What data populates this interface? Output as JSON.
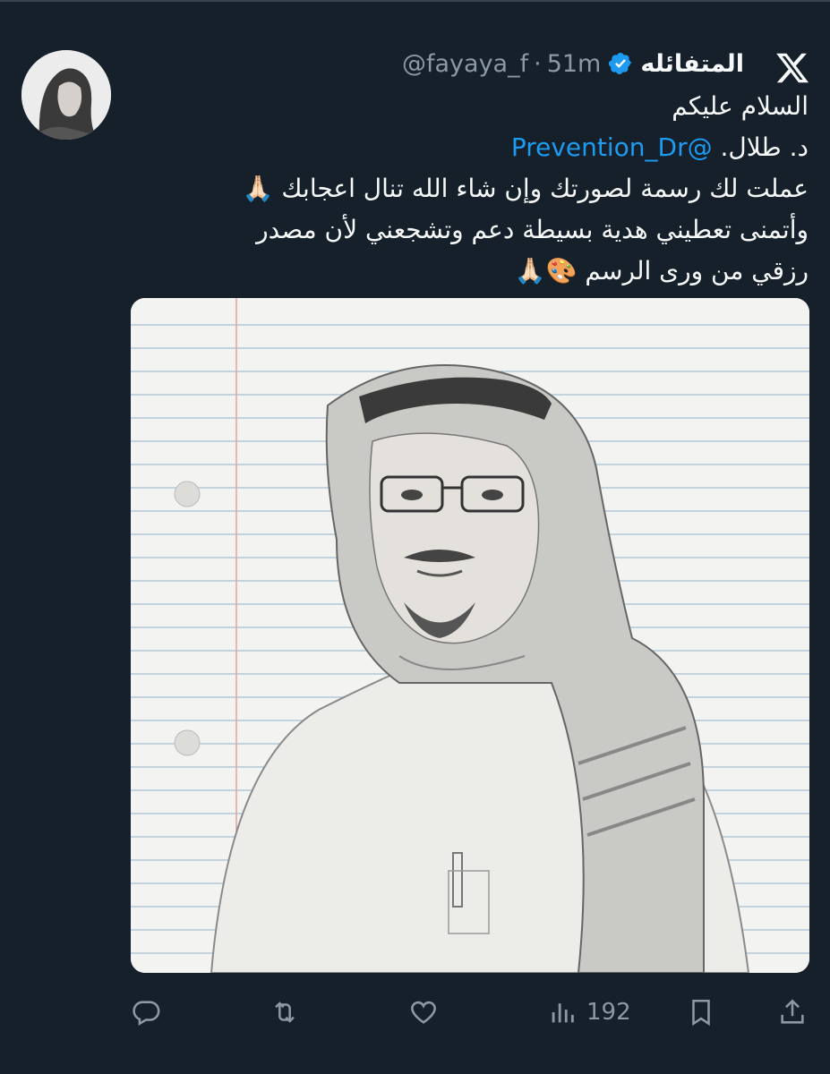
{
  "tweet": {
    "display_name": "المتفائله",
    "handle": "@fayaya_f",
    "separator": "·",
    "time": "51m",
    "lines": [
      {
        "text": "السلام عليكم"
      },
      {
        "mention": "@Prevention_Dr",
        "text": "د. طلال."
      },
      {
        "text": "عملت لك رسمة لصورتك وإن شاء الله  تنال اعجابك",
        "emoji": "🙏🏻"
      },
      {
        "text": "وأتمنى تعطيني هدية بسيطة دعم  وتشجعني لأن مصدر"
      },
      {
        "text": "رزقي من ورى الرسم",
        "emoji": "🎨🙏🏻"
      }
    ],
    "media": {
      "description_icon": "pencil-portrait-drawing"
    }
  },
  "actions": {
    "reply": {
      "icon": "reply-icon"
    },
    "retweet": {
      "icon": "retweet-icon"
    },
    "like": {
      "icon": "heart-icon"
    },
    "views": {
      "icon": "views-icon",
      "count": "192"
    },
    "bookmark": {
      "icon": "bookmark-icon"
    },
    "share": {
      "icon": "share-icon"
    }
  },
  "colors": {
    "background": "#15202b",
    "accent": "#1d9bf0",
    "muted": "#8b98a5",
    "text": "#f7f9f9"
  }
}
